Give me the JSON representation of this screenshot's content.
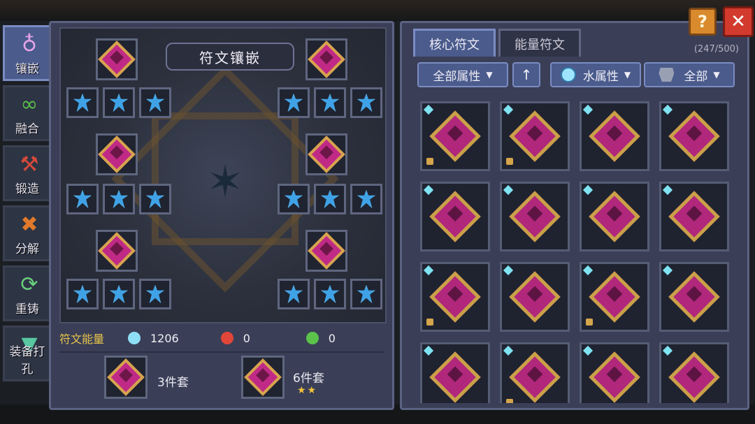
{
  "side_nav": [
    {
      "label": "镶嵌",
      "icon": "socket-icon",
      "glyph": "♁",
      "active": true
    },
    {
      "label": "融合",
      "icon": "merge-icon",
      "glyph": "∞",
      "active": false
    },
    {
      "label": "锻造",
      "icon": "forge-icon",
      "glyph": "⚒",
      "active": false
    },
    {
      "label": "分解",
      "icon": "dismantle-icon",
      "glyph": "✖",
      "active": false
    },
    {
      "label": "重铸",
      "icon": "recast-icon",
      "glyph": "⟳",
      "active": false
    },
    {
      "label": "装备打孔",
      "icon": "drill-icon",
      "glyph": "▼",
      "active": false
    }
  ],
  "socket_panel": {
    "title": "符文镶嵌",
    "energy_label": "符文能量",
    "energies": [
      {
        "type": "water",
        "value": "1206",
        "color": "#8fe0f6"
      },
      {
        "type": "fire",
        "value": "0",
        "color": "#e0463a"
      },
      {
        "type": "nature",
        "value": "0",
        "color": "#5bc24a"
      }
    ],
    "sets": [
      {
        "label": "3件套",
        "stars": ""
      },
      {
        "label": "6件套",
        "stars": "★★"
      }
    ]
  },
  "inventory_panel": {
    "tabs": [
      {
        "label": "核心符文",
        "active": true
      },
      {
        "label": "能量符文",
        "active": false
      }
    ],
    "count": "(247/500)",
    "filters": {
      "attribute": "全部属性",
      "sort": "↑",
      "element": "水属性",
      "category": "全部"
    },
    "cards": [
      {
        "locked": true
      },
      {
        "locked": true
      },
      {
        "locked": false
      },
      {
        "locked": false
      },
      {
        "locked": false
      },
      {
        "locked": false
      },
      {
        "locked": false
      },
      {
        "locked": false
      },
      {
        "locked": true
      },
      {
        "locked": false
      },
      {
        "locked": true
      },
      {
        "locked": false
      },
      {
        "locked": false
      },
      {
        "locked": true
      },
      {
        "locked": false
      },
      {
        "locked": false
      }
    ]
  },
  "top_buttons": {
    "help": "?",
    "close": "✕"
  },
  "colors": {
    "accent": "#4a5b8c",
    "panel": "#3a3f57",
    "gold": "#e9c54a"
  }
}
